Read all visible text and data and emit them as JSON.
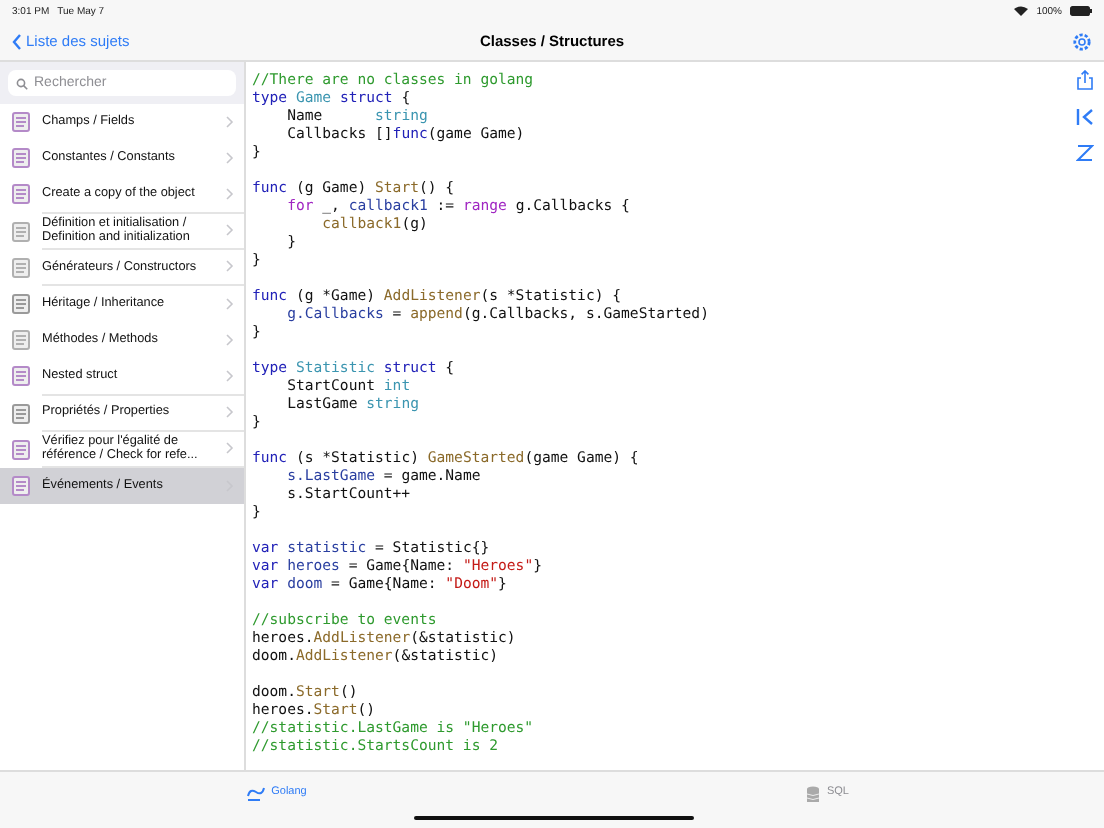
{
  "status_bar": {
    "time": "3:01 PM",
    "date": "Tue May 7",
    "battery": "100%"
  },
  "nav": {
    "back": "Liste des sujets",
    "title": "Classes / Structures"
  },
  "search": {
    "placeholder": "Rechercher"
  },
  "topics": [
    {
      "label": "Champs / Fields",
      "color": "#b48ac8",
      "selected": false
    },
    {
      "label": "Constantes / Constants",
      "color": "#b48ac8",
      "selected": false
    },
    {
      "label": "Create a copy of the object",
      "color": "#b48ac8",
      "selected": false
    },
    {
      "label": "Définition et initialisation / Definition and initialization",
      "color": "#b0b0b0",
      "selected": false
    },
    {
      "label": "Générateurs  / Constructors",
      "color": "#b0b0b0",
      "selected": false
    },
    {
      "label": "Héritage / Inheritance",
      "color": "#9a9a9a",
      "selected": false
    },
    {
      "label": "Méthodes / Methods",
      "color": "#b0b0b0",
      "selected": false
    },
    {
      "label": "Nested struct",
      "color": "#b48ac8",
      "selected": false
    },
    {
      "label": "Propriétés / Properties",
      "color": "#9a9a9a",
      "selected": false
    },
    {
      "label": "Vérifiez pour l'égalité de référence / Check for refe...",
      "color": "#b48ac8",
      "selected": false
    },
    {
      "label": "Événements / Events",
      "color": "#b48ac8",
      "selected": true
    }
  ],
  "code": [
    {
      "kind": "code",
      "segments": [
        {
          "kind": "comment",
          "text": "//There are no classes in golang"
        }
      ]
    },
    {
      "kind": "code",
      "segments": [
        {
          "kind": "keyword",
          "text": "type "
        },
        {
          "kind": "type",
          "text": "Game"
        },
        {
          "kind": "keyword",
          "text": " struct"
        },
        {
          "kind": "plain",
          "text": " {"
        }
      ]
    },
    {
      "kind": "code",
      "segments": [
        {
          "kind": "plain",
          "text": "    Name      "
        },
        {
          "kind": "type",
          "text": "string"
        }
      ]
    },
    {
      "kind": "code",
      "segments": [
        {
          "kind": "plain",
          "text": "    Callbacks []"
        },
        {
          "kind": "keyword",
          "text": "func"
        },
        {
          "kind": "plain",
          "text": "(game Game)"
        }
      ]
    },
    {
      "kind": "code",
      "segments": [
        {
          "kind": "plain",
          "text": "}"
        }
      ]
    },
    {
      "kind": "blank"
    },
    {
      "kind": "code",
      "segments": [
        {
          "kind": "keyword",
          "text": "func"
        },
        {
          "kind": "plain",
          "text": " (g Game) "
        },
        {
          "kind": "func",
          "text": "Start"
        },
        {
          "kind": "plain",
          "text": "() {"
        }
      ]
    },
    {
      "kind": "code",
      "segments": [
        {
          "kind": "control",
          "text": "    for"
        },
        {
          "kind": "plain",
          "text": " _, "
        },
        {
          "kind": "field",
          "text": "callback1"
        },
        {
          "kind": "plain",
          "text": " := "
        },
        {
          "kind": "control",
          "text": "range"
        },
        {
          "kind": "plain",
          "text": " g.Callbacks {"
        }
      ]
    },
    {
      "kind": "code",
      "segments": [
        {
          "kind": "func",
          "text": "        callback1"
        },
        {
          "kind": "plain",
          "text": "(g)"
        }
      ]
    },
    {
      "kind": "code",
      "segments": [
        {
          "kind": "plain",
          "text": "    }"
        }
      ]
    },
    {
      "kind": "code",
      "segments": [
        {
          "kind": "plain",
          "text": "}"
        }
      ]
    },
    {
      "kind": "blank"
    },
    {
      "kind": "code",
      "segments": [
        {
          "kind": "keyword",
          "text": "func"
        },
        {
          "kind": "plain",
          "text": " (g *Game) "
        },
        {
          "kind": "func",
          "text": "AddListener"
        },
        {
          "kind": "plain",
          "text": "(s *Statistic) {"
        }
      ]
    },
    {
      "kind": "code",
      "segments": [
        {
          "kind": "field",
          "text": "    g.Callbacks"
        },
        {
          "kind": "plain",
          "text": " = "
        },
        {
          "kind": "func",
          "text": "append"
        },
        {
          "kind": "plain",
          "text": "(g.Callbacks, s.GameStarted)"
        }
      ]
    },
    {
      "kind": "code",
      "segments": [
        {
          "kind": "plain",
          "text": "}"
        }
      ]
    },
    {
      "kind": "blank"
    },
    {
      "kind": "code",
      "segments": [
        {
          "kind": "keyword",
          "text": "type "
        },
        {
          "kind": "type",
          "text": "Statistic"
        },
        {
          "kind": "keyword",
          "text": " struct"
        },
        {
          "kind": "plain",
          "text": " {"
        }
      ]
    },
    {
      "kind": "code",
      "segments": [
        {
          "kind": "plain",
          "text": "    StartCount "
        },
        {
          "kind": "type",
          "text": "int"
        }
      ]
    },
    {
      "kind": "code",
      "segments": [
        {
          "kind": "plain",
          "text": "    LastGame "
        },
        {
          "kind": "type",
          "text": "string"
        }
      ]
    },
    {
      "kind": "code",
      "segments": [
        {
          "kind": "plain",
          "text": "}"
        }
      ]
    },
    {
      "kind": "blank"
    },
    {
      "kind": "code",
      "segments": [
        {
          "kind": "keyword",
          "text": "func"
        },
        {
          "kind": "plain",
          "text": " (s *Statistic) "
        },
        {
          "kind": "func",
          "text": "GameStarted"
        },
        {
          "kind": "plain",
          "text": "(game Game) {"
        }
      ]
    },
    {
      "kind": "code",
      "segments": [
        {
          "kind": "field",
          "text": "    s.LastGame"
        },
        {
          "kind": "plain",
          "text": " = game.Name"
        }
      ]
    },
    {
      "kind": "code",
      "segments": [
        {
          "kind": "plain",
          "text": "    s.StartCount++"
        }
      ]
    },
    {
      "kind": "code",
      "segments": [
        {
          "kind": "plain",
          "text": "}"
        }
      ]
    },
    {
      "kind": "blank"
    },
    {
      "kind": "code",
      "segments": [
        {
          "kind": "keyword",
          "text": "var "
        },
        {
          "kind": "field",
          "text": "statistic"
        },
        {
          "kind": "plain",
          "text": " = Statistic{}"
        }
      ]
    },
    {
      "kind": "code",
      "segments": [
        {
          "kind": "keyword",
          "text": "var "
        },
        {
          "kind": "field",
          "text": "heroes"
        },
        {
          "kind": "plain",
          "text": " = Game{Name: "
        },
        {
          "kind": "string",
          "text": "\"Heroes\""
        },
        {
          "kind": "plain",
          "text": "}"
        }
      ]
    },
    {
      "kind": "code",
      "segments": [
        {
          "kind": "keyword",
          "text": "var "
        },
        {
          "kind": "field",
          "text": "doom"
        },
        {
          "kind": "plain",
          "text": " = Game{Name: "
        },
        {
          "kind": "string",
          "text": "\"Doom\""
        },
        {
          "kind": "plain",
          "text": "}"
        }
      ]
    },
    {
      "kind": "blank"
    },
    {
      "kind": "code",
      "segments": [
        {
          "kind": "comment",
          "text": "//subscribe to events"
        }
      ]
    },
    {
      "kind": "code",
      "segments": [
        {
          "kind": "plain",
          "text": "heroes."
        },
        {
          "kind": "func",
          "text": "AddListener"
        },
        {
          "kind": "plain",
          "text": "(&statistic)"
        }
      ]
    },
    {
      "kind": "code",
      "segments": [
        {
          "kind": "plain",
          "text": "doom."
        },
        {
          "kind": "func",
          "text": "AddListener"
        },
        {
          "kind": "plain",
          "text": "(&statistic)"
        }
      ]
    },
    {
      "kind": "blank"
    },
    {
      "kind": "code",
      "segments": [
        {
          "kind": "plain",
          "text": "doom."
        },
        {
          "kind": "func",
          "text": "Start"
        },
        {
          "kind": "plain",
          "text": "()"
        }
      ]
    },
    {
      "kind": "code",
      "segments": [
        {
          "kind": "plain",
          "text": "heroes."
        },
        {
          "kind": "func",
          "text": "Start"
        },
        {
          "kind": "plain",
          "text": "()"
        }
      ]
    },
    {
      "kind": "code",
      "segments": [
        {
          "kind": "comment",
          "text": "//statistic.LastGame is \"Heroes\""
        }
      ]
    },
    {
      "kind": "code",
      "segments": [
        {
          "kind": "comment",
          "text": "//statistic.StartsCount is 2"
        }
      ]
    }
  ],
  "tabs": [
    {
      "label": "Golang",
      "kind": "golang",
      "selected": true
    },
    {
      "label": "SQL",
      "kind": "sql",
      "selected": false
    }
  ]
}
